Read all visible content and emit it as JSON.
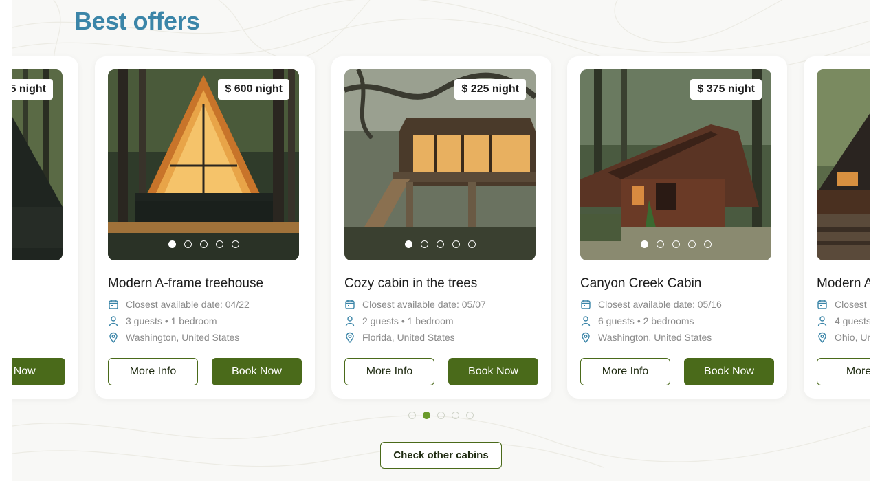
{
  "section": {
    "title": "Best offers"
  },
  "colors": {
    "title": "#3b85a8",
    "accent": "#4a6a1a",
    "active_dot": "#6a9a2a"
  },
  "cards": [
    {
      "price_fragment": "5 night",
      "name_fragment": "",
      "book_fragment": "k Now"
    },
    {
      "price": "$ 600 night",
      "name": "Modern A-frame treehouse",
      "date": "Closest available date: 04/22",
      "guests": "3 guests • 1 bedroom",
      "location": "Washington, United States",
      "more": "More Info",
      "book": "Book Now"
    },
    {
      "price": "$ 225 night",
      "name": "Cozy cabin in the trees",
      "date": "Closest available date: 05/07",
      "guests": "2 guests • 1 bedroom",
      "location": "Florida, United States",
      "more": "More Info",
      "book": "Book Now"
    },
    {
      "price": "$ 375 night",
      "name": "Canyon Creek Cabin",
      "date": "Closest available date: 05/16",
      "guests": "6 guests • 2 bedrooms",
      "location": "Washington, United States",
      "more": "More Info",
      "book": "Book Now"
    },
    {
      "name_fragment": "Modern A",
      "date_fragment": "Closest a",
      "guests_fragment": "4 guests",
      "location_fragment": "Ohio, Ur",
      "more_fragment": "More I"
    }
  ],
  "photo_slider": {
    "dot_count": 5,
    "active_index": 0
  },
  "carousel": {
    "dot_count": 5,
    "active_index": 1
  },
  "footer": {
    "check_label": "Check other cabins"
  },
  "icons": [
    "calendar-icon",
    "person-icon",
    "location-pin-icon"
  ]
}
